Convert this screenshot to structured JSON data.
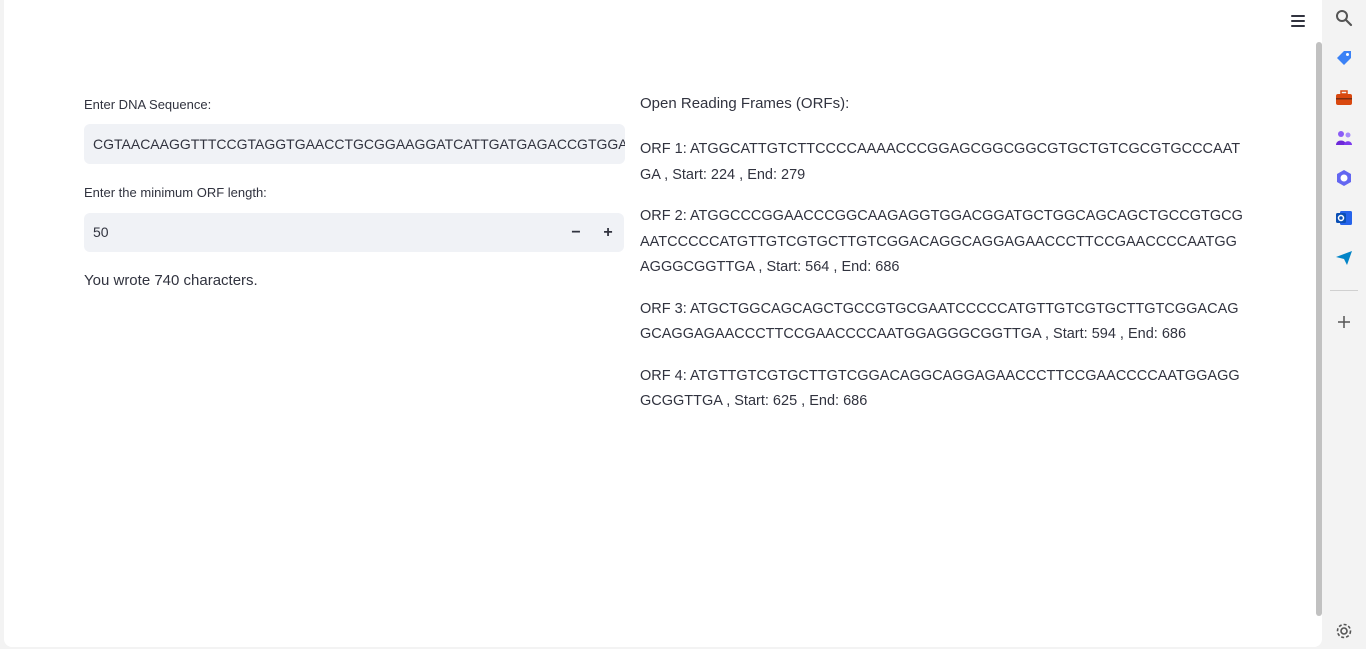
{
  "left": {
    "dna_label": "Enter DNA Sequence:",
    "dna_value": "CGTAACAAGGTTTCCGTAGGTGAACCTGCGGAAGGATCATTGATGAGACCGTGGAATAA",
    "min_orf_label": "Enter the minimum ORF length:",
    "min_orf_value": "50",
    "decrement": "−",
    "increment": "+",
    "char_count_text": "You wrote 740 characters."
  },
  "right": {
    "heading": "Open Reading Frames (ORFs):",
    "orfs": [
      "ORF 1: ATGGCATTGTCTTCCCCAAAACCCGGAGCGGCGGCGTGCTGTCGCGTGCCCAATGA , Start: 224 , End: 279",
      "ORF 2: ATGGCCCGGAACCCGGCAAGAGGTGGACGGATGCTGGCAGCAGCTGCCGTGCGAATCCCCCATGTTGTCGTGCTTGTCGGACAGGCAGGAGAACCCTTCCGAACCCCAATGGAGGGCGGTTGA , Start: 564 , End: 686",
      "ORF 3: ATGCTGGCAGCAGCTGCCGTGCGAATCCCCCATGTTGTCGTGCTTGTCGGACAGGCAGGAGAACCCTTCCGAACCCCAATGGAGGGCGGTTGA , Start: 594 , End: 686",
      "ORF 4: ATGTTGTCGTGCTTGTCGGACAGGCAGGAGAACCCTTCCGAACCCCAATGGAGGGCGGTTGA , Start: 625 , End: 686"
    ]
  },
  "sidebar": {
    "icons": [
      "search-icon",
      "tag-icon",
      "toolbox-icon",
      "people-icon",
      "copilot-icon",
      "outlook-icon",
      "send-icon",
      "add-icon",
      "settings-icon"
    ]
  },
  "colors": {
    "input_bg": "#f0f2f6",
    "text": "#31333f"
  }
}
